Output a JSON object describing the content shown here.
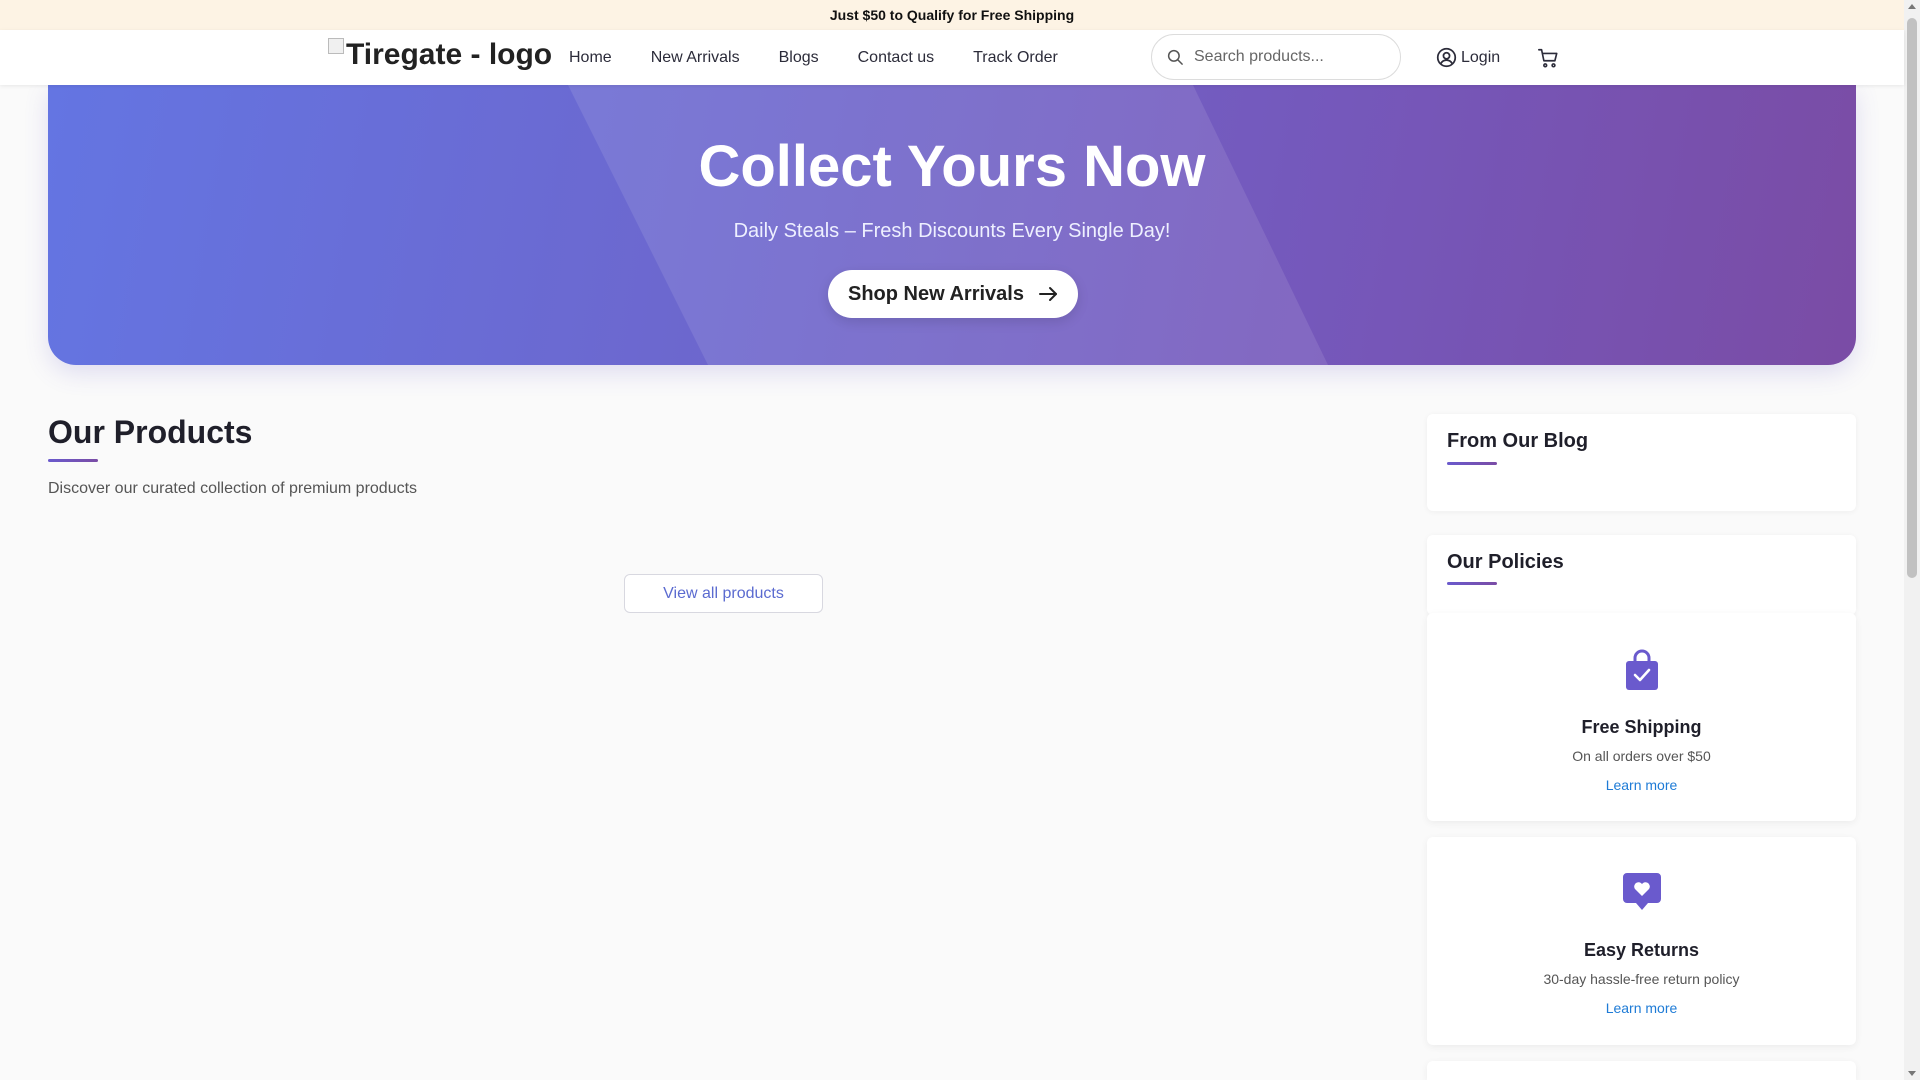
{
  "announcement": "Just $50 to Qualify for Free Shipping",
  "header": {
    "logo_alt": "Tiregate - logo",
    "nav": [
      "Home",
      "New Arrivals",
      "Blogs",
      "Contact us",
      "Track Order"
    ],
    "search_placeholder": "Search products...",
    "login_label": "Login",
    "icons": {
      "search": "search-icon",
      "user": "user-circle-icon",
      "cart": "cart-icon"
    }
  },
  "hero": {
    "title": "Collect Yours Now",
    "subtitle": "Daily Steals – Fresh Discounts Every Single Day!",
    "cta_label": "Shop New Arrivals"
  },
  "products": {
    "title": "Our Products",
    "subtitle": "Discover our curated collection of premium products",
    "view_all_label": "View all products"
  },
  "sidebar": {
    "blog_title": "From Our Blog",
    "policies_title": "Our Policies",
    "policies": [
      {
        "icon": "shopping-bag-check-icon",
        "title": "Free Shipping",
        "desc": "On all orders over $50",
        "link": "Learn more"
      },
      {
        "icon": "heart-message-icon",
        "title": "Easy Returns",
        "desc": "30-day hassle-free return policy",
        "link": "Learn more"
      }
    ]
  },
  "colors": {
    "accent": "#6a5acd",
    "link": "#1e7bd6",
    "announcement_bg": "#fdf3e4",
    "hero_start": "#6475e2",
    "hero_end": "#7a4ca5"
  }
}
